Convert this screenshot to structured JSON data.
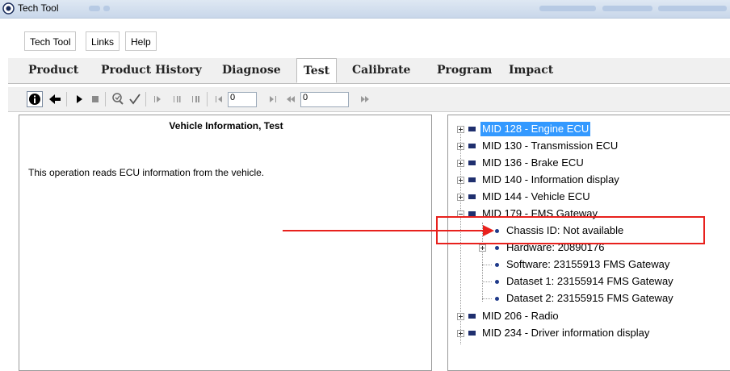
{
  "window": {
    "title": "Tech Tool"
  },
  "menu": {
    "items": [
      "Tech Tool",
      "Links",
      "Help"
    ]
  },
  "tabs": [
    {
      "label": "Product",
      "active": false
    },
    {
      "label": "Product History",
      "active": false
    },
    {
      "label": "Diagnose",
      "active": false
    },
    {
      "label": "Test",
      "active": true
    },
    {
      "label": "Calibrate",
      "active": false
    },
    {
      "label": "Program",
      "active": false
    },
    {
      "label": "Impact",
      "active": false
    }
  ],
  "toolbar": {
    "frame_input_value": "0",
    "speed_input_value": "0",
    "icons": [
      "info-icon",
      "back-arrow-icon",
      "play-icon",
      "stop-icon",
      "inspect-icon",
      "check-icon",
      "step-icon",
      "pause-icon",
      "pause-step-icon",
      "go-start-icon",
      "next-frame-icon",
      "rewind-icon",
      "fast-forward-icon"
    ]
  },
  "left_panel": {
    "title": "Vehicle Information, Test",
    "description": "This operation reads ECU information from the vehicle."
  },
  "tree": {
    "mid128": "MID 128 - Engine ECU",
    "mid130": "MID 130 - Transmission ECU",
    "mid136": "MID 136 - Brake ECU",
    "mid140": "MID 140 - Information display",
    "mid144": "MID 144 - Vehicle ECU",
    "mid179": "MID 179 - FMS Gateway",
    "chassis": "Chassis ID:  Not available",
    "hardware": "Hardware:  20890176",
    "software": "Software:  23155913 FMS Gateway",
    "dataset1": "Dataset 1:  23155914 FMS Gateway",
    "dataset2": "Dataset 2:  23155915 FMS Gateway",
    "mid206": "MID 206 - Radio",
    "mid234": "MID 234 - Driver information display"
  },
  "colors": {
    "highlight": "#e8211d",
    "selection": "#3399ff",
    "module_icon": "#1f2f6e"
  }
}
